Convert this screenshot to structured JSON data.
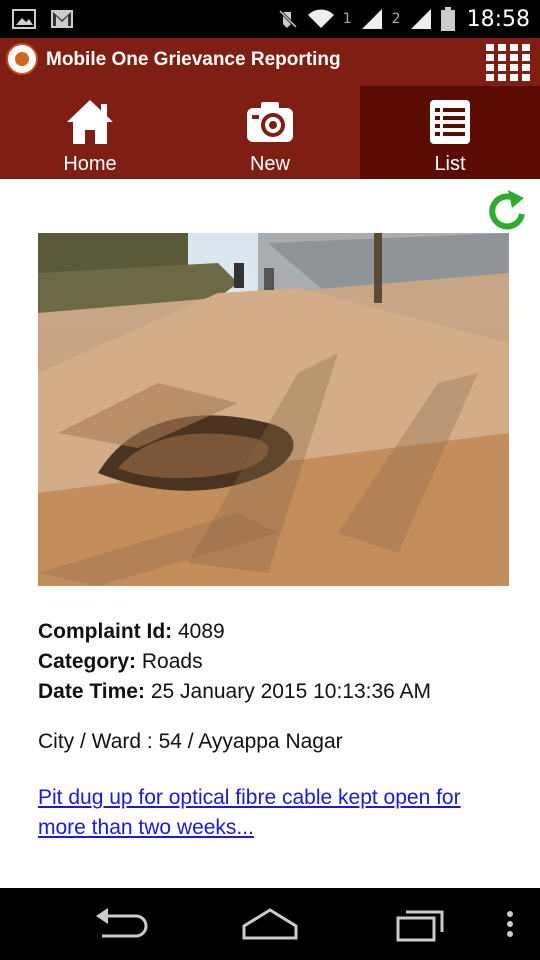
{
  "status_bar": {
    "sim1": "1",
    "sim2": "2",
    "time": "18:58",
    "icons": [
      "image-icon",
      "gmail-icon",
      "mute-icon",
      "wifi-icon",
      "signal-icon",
      "battery-icon"
    ]
  },
  "header": {
    "title": "Mobile One Grievance Reporting",
    "accent": "#7f1e13",
    "active_tab_color": "#5a0c05"
  },
  "tabs": [
    {
      "label": "Home",
      "icon": "home-icon"
    },
    {
      "label": "New",
      "icon": "camera-icon"
    },
    {
      "label": "List",
      "icon": "list-icon",
      "active": true
    }
  ],
  "complaint": {
    "id_label": "Complaint Id:",
    "id_value": "4089",
    "category_label": "Category:",
    "category_value": "Roads",
    "datetime_label": "Date Time:",
    "datetime_value": "25 January 2015 10:13:36 AM",
    "city_ward": "City / Ward : 54 / Ayyappa Nagar",
    "description": "Pit dug up for optical fibre cable kept open for more than two weeks..."
  },
  "nav": {
    "icons": [
      "back-icon",
      "home-nav-icon",
      "recents-icon",
      "overflow-menu-icon"
    ]
  }
}
